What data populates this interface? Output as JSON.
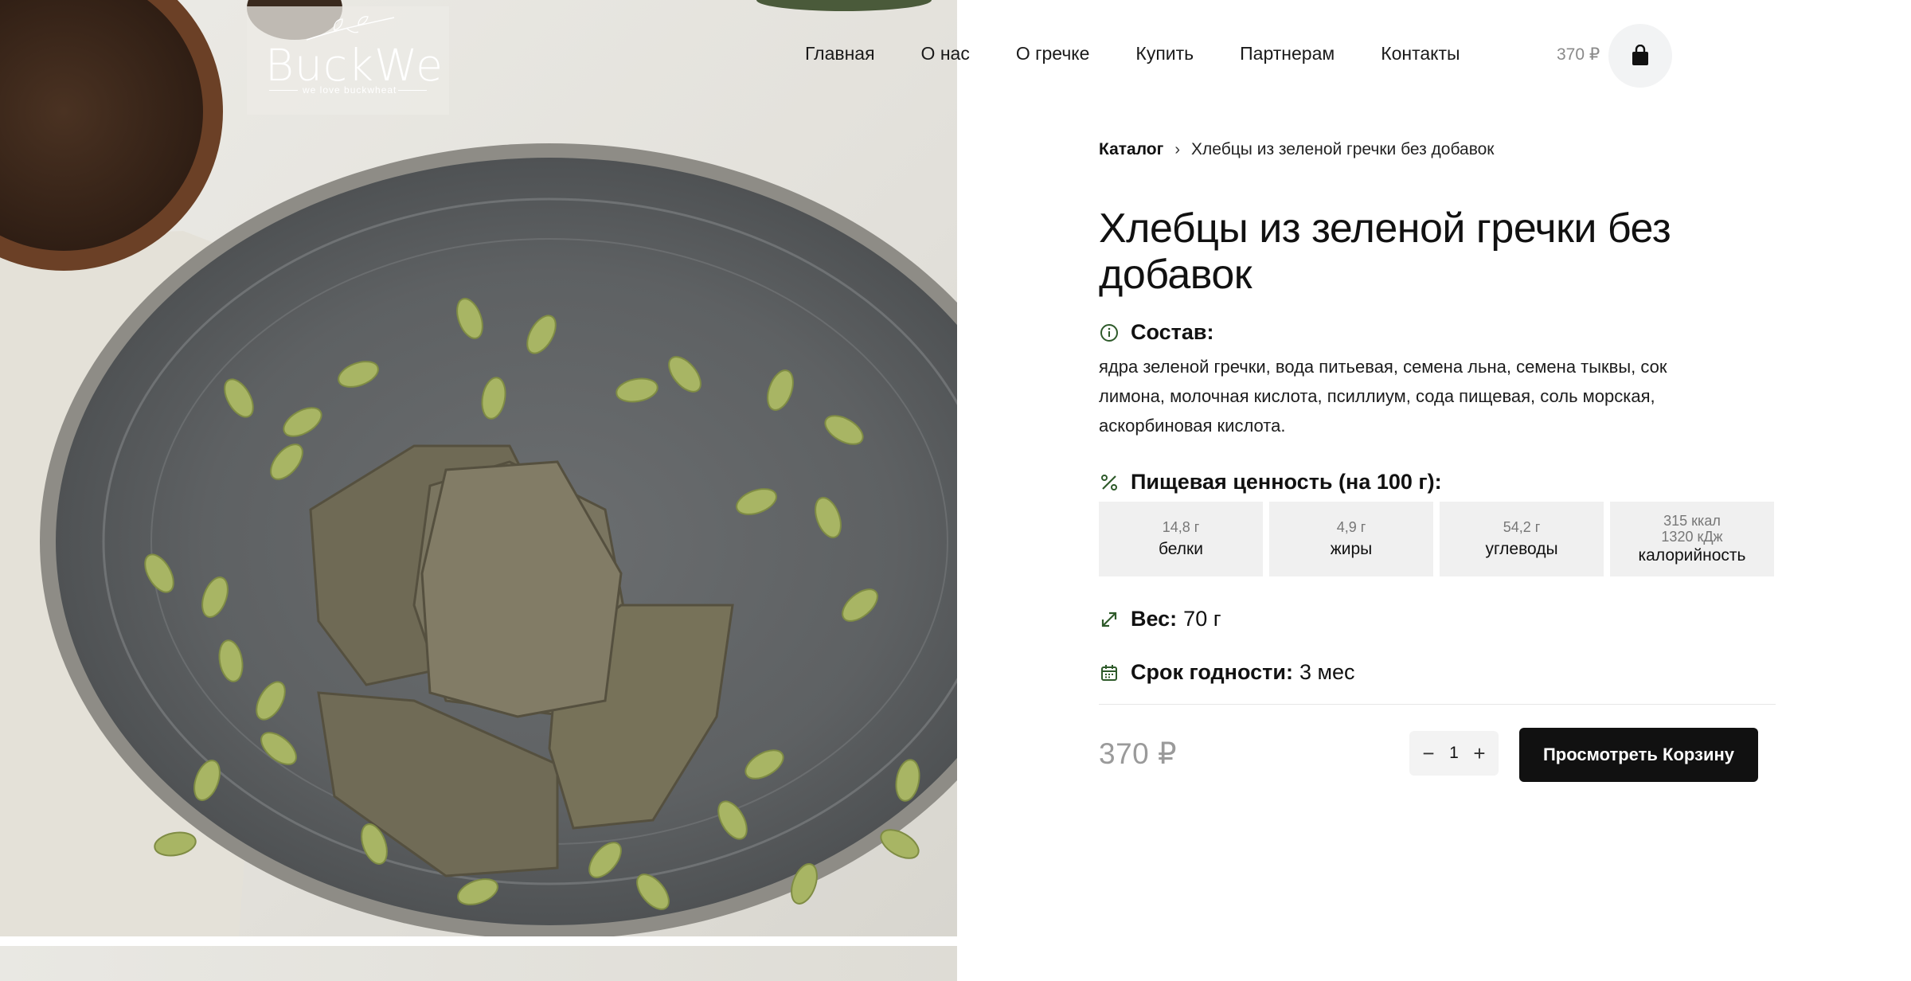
{
  "brand": {
    "name": "BuckWe",
    "tagline": "we love buckwheat"
  },
  "nav": {
    "items": [
      "Главная",
      "О нас",
      "О гречке",
      "Купить",
      "Партнерам",
      "Контакты"
    ],
    "cart_total": "370 ₽",
    "cart_icon": "shopping-bag-icon"
  },
  "breadcrumb": {
    "home": "Каталог",
    "current": "Хлебцы из зеленой гречки без добавок"
  },
  "product": {
    "title": "Хлебцы из зеленой гречки без добавок",
    "composition_label": "Состав:",
    "composition_text": "ядра зеленой гречки, вода питьевая, семена льна, семена тыквы, сок лимона, молочная кислота, псиллиум, сода пищевая, соль морская, аскорбиновая кислота.",
    "nutrition_label": "Пищевая ценность (на 100 г):",
    "nutrition": [
      {
        "amount": "14,8 г",
        "amount2": "",
        "label": "белки"
      },
      {
        "amount": "4,9 г",
        "amount2": "",
        "label": "жиры"
      },
      {
        "amount": "54,2 г",
        "amount2": "",
        "label": "углеводы"
      },
      {
        "amount": "315 ккал",
        "amount2": "1320 кДж",
        "label": "калорийность"
      }
    ],
    "weight_label": "Вес:",
    "weight_value": "70 г",
    "shelf_label": "Срок годности:",
    "shelf_value": "3 мес",
    "price": "370 ₽",
    "quantity": "1",
    "minus": "−",
    "plus": "+",
    "cart_button": "Просмотреть Корзину"
  },
  "colors": {
    "accent_icon": "#2e5a2a",
    "button_bg": "#111111",
    "price_muted": "#9a9a9a"
  }
}
